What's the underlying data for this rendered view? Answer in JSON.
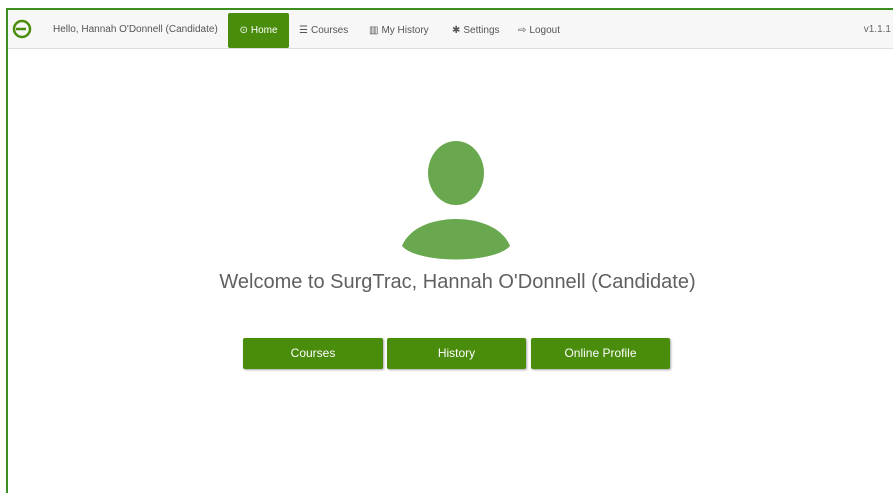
{
  "navbar": {
    "greeting": "Hello, Hannah O'Donnell (Candidate)",
    "items": [
      {
        "label": "Home",
        "icon": "clock-icon",
        "active": true
      },
      {
        "label": "Courses",
        "icon": "list-icon",
        "active": false
      },
      {
        "label": "My History",
        "icon": "bar-chart-icon",
        "active": false
      },
      {
        "label": "Settings",
        "icon": "gear-icon",
        "active": false
      },
      {
        "label": "Logout",
        "icon": "logout-icon",
        "active": false
      }
    ],
    "version": "v1.1.1"
  },
  "main": {
    "avatar_icon": "user-avatar-icon",
    "welcome": "Welcome to SurgTrac, Hannah O'Donnell (Candidate)",
    "buttons": {
      "courses": "Courses",
      "history": "History",
      "profile": "Online Profile"
    }
  },
  "colors": {
    "accent": "#4a8c0c",
    "avatar": "#6aa84f",
    "frame": "#3e8e1f"
  }
}
